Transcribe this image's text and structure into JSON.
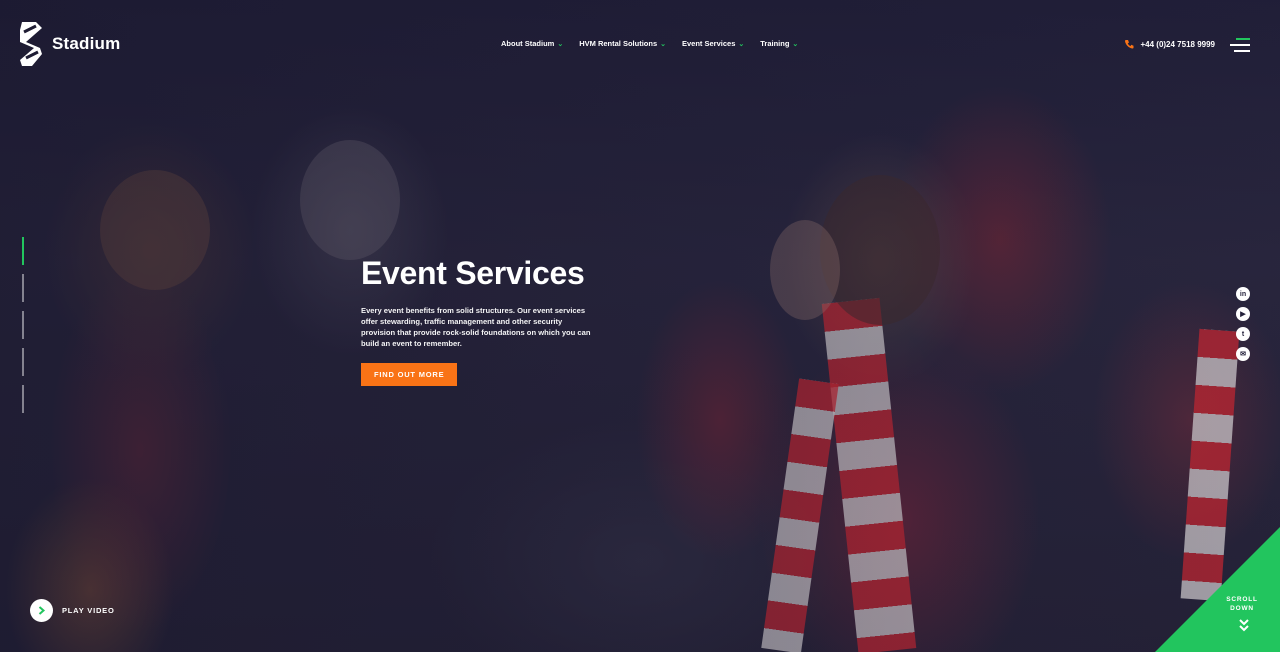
{
  "brand": {
    "name": "Stadium",
    "accent": "#22c55e",
    "cta_color": "#f97316"
  },
  "nav": {
    "items": [
      {
        "label": "About Stadium"
      },
      {
        "label": "HVM Rental Solutions"
      },
      {
        "label": "Event Services"
      },
      {
        "label": "Training"
      }
    ]
  },
  "header": {
    "phone": "+44 (0)24 7518 9999",
    "phone_icon": "phone-icon",
    "menu_icon": "hamburger-icon"
  },
  "hero": {
    "title": "Event Services",
    "description": "Every event benefits from solid structures. Our event services offer stewarding, traffic management and other security provision that provide rock-solid foundations on which you can build an event to remember.",
    "cta_label": "FIND OUT MORE"
  },
  "slides": {
    "count": 5,
    "active_index": 0
  },
  "social": [
    {
      "name": "linkedin-icon",
      "glyph": "in"
    },
    {
      "name": "youtube-icon",
      "glyph": "▶"
    },
    {
      "name": "twitter-icon",
      "glyph": "t"
    },
    {
      "name": "email-icon",
      "glyph": "✉"
    }
  ],
  "video": {
    "label": "PLAY VIDEO"
  },
  "scroll": {
    "line1": "SCROLL",
    "line2": "DOWN"
  }
}
